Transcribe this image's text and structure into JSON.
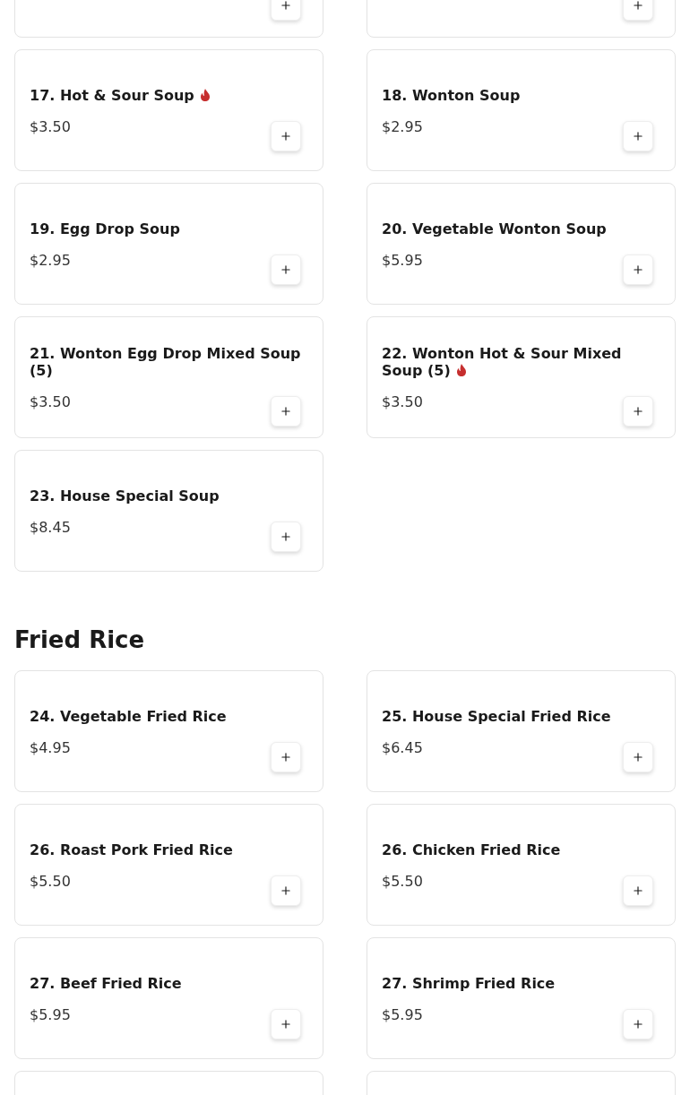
{
  "sections": [
    {
      "items": [
        {
          "kind": "cut"
        },
        {
          "kind": "cut"
        },
        {
          "kind": "item",
          "name": "17. Hot & Sour Soup",
          "spicy": true,
          "price": "$3.50"
        },
        {
          "kind": "item",
          "name": "18. Wonton Soup",
          "spicy": false,
          "price": "$2.95"
        },
        {
          "kind": "item",
          "name": "19. Egg Drop Soup",
          "spicy": false,
          "price": "$2.95"
        },
        {
          "kind": "item",
          "name": "20. Vegetable Wonton Soup",
          "spicy": false,
          "price": "$5.95"
        },
        {
          "kind": "item",
          "name": "21. Wonton Egg Drop Mixed Soup (5)",
          "spicy": false,
          "price": "$3.50"
        },
        {
          "kind": "item",
          "name": "22. Wonton Hot & Sour Mixed Soup (5)",
          "spicy": true,
          "price": "$3.50"
        },
        {
          "kind": "item",
          "name": "23. House Special Soup",
          "spicy": false,
          "price": "$8.45"
        }
      ]
    },
    {
      "title": "Fried Rice",
      "items": [
        {
          "kind": "item",
          "name": "24. Vegetable Fried Rice",
          "spicy": false,
          "price": "$4.95"
        },
        {
          "kind": "item",
          "name": "25. House Special Fried Rice",
          "spicy": false,
          "price": "$6.45"
        },
        {
          "kind": "item",
          "name": "26. Roast Pork Fried Rice",
          "spicy": false,
          "price": "$5.50"
        },
        {
          "kind": "item",
          "name": "26. Chicken Fried Rice",
          "spicy": false,
          "price": "$5.50"
        },
        {
          "kind": "item",
          "name": "27. Beef Fried Rice",
          "spicy": false,
          "price": "$5.95"
        },
        {
          "kind": "item",
          "name": "27. Shrimp Fried Rice",
          "spicy": false,
          "price": "$5.95"
        },
        {
          "kind": "edge"
        },
        {
          "kind": "edge"
        }
      ]
    }
  ]
}
